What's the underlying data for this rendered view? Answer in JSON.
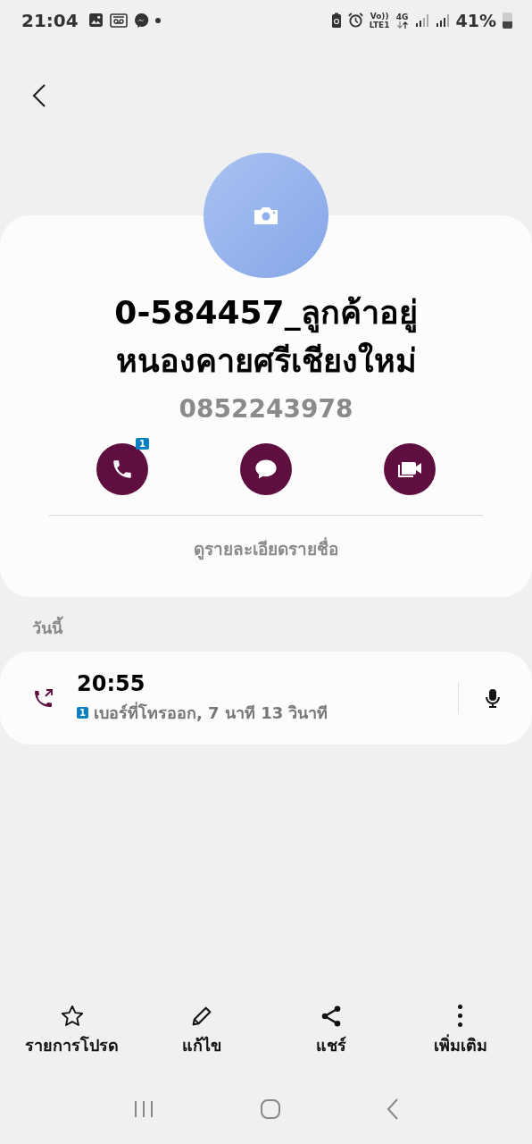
{
  "status_bar": {
    "time": "21:04",
    "volte": "Vo))",
    "lte": "LTE1",
    "network": "4G",
    "battery": "41%"
  },
  "contact": {
    "name": "0-584457_ลูกค้าอยู่หนองคายศรีเชียงใหม่",
    "phone": "0852243978",
    "link": "ดูรายละเอียดรายชื่อ"
  },
  "actions": [
    {
      "kind": "call",
      "badge": "1"
    },
    {
      "kind": "message"
    },
    {
      "kind": "video"
    }
  ],
  "section": "วันนี้",
  "calls": [
    {
      "kind": "outgoing",
      "time": "20:55",
      "sim": "1",
      "detail": "เบอร์ที่โทรออก, 7 นาที 13 วินาที"
    }
  ],
  "bottom_actions": [
    {
      "kind": "favorite",
      "label": "รายการโปรด"
    },
    {
      "kind": "edit",
      "label": "แก้ไข"
    },
    {
      "kind": "share",
      "label": "แชร์"
    },
    {
      "kind": "more",
      "label": "เพิ่มเติม"
    }
  ]
}
